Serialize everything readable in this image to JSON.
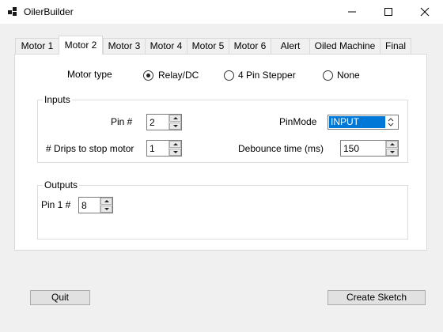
{
  "window": {
    "title": "OilerBuilder"
  },
  "tabs": [
    {
      "label": "Motor 1"
    },
    {
      "label": "Motor 2",
      "active": true
    },
    {
      "label": "Motor 3"
    },
    {
      "label": "Motor 4"
    },
    {
      "label": "Motor 5"
    },
    {
      "label": "Motor 6"
    },
    {
      "label": "Alert"
    },
    {
      "label": "Oiled Machine"
    },
    {
      "label": "Final"
    }
  ],
  "motor_type": {
    "label": "Motor type",
    "options": [
      {
        "label": "Relay/DC",
        "checked": true
      },
      {
        "label": "4 Pin Stepper",
        "checked": false
      },
      {
        "label": "None",
        "checked": false
      }
    ]
  },
  "inputs": {
    "title": "Inputs",
    "pin_label": "Pin #",
    "pin_value": "2",
    "pinmode_label": "PinMode",
    "pinmode_value": "INPUT",
    "drips_label": "# Drips to stop motor",
    "drips_value": "1",
    "debounce_label": "Debounce time (ms)",
    "debounce_value": "150"
  },
  "outputs": {
    "title": "Outputs",
    "pin1_label": "Pin 1 #",
    "pin1_value": "8"
  },
  "buttons": {
    "quit": "Quit",
    "create_sketch": "Create Sketch"
  },
  "colors": {
    "selection": "#0078d7",
    "window_bg": "#f0f0f0"
  }
}
